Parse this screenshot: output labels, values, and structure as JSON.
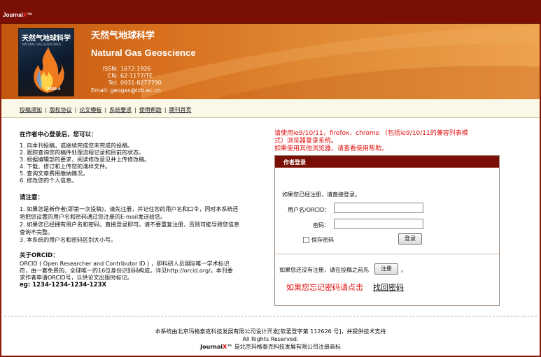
{
  "topbar": {
    "brand_prefix": "Journal",
    "brand_x": "X",
    "brand_tm": "™"
  },
  "journal": {
    "title_cn": "天然气地球科学",
    "title_en": "Natural Gas Geoscience",
    "cover_title": "天然气地球科学",
    "cover_subtitle": "NATURAL GAS GEOSCIENCE",
    "cover_year": "2020.4",
    "issn_label": "ISSN:",
    "issn": "1672-1926",
    "cn_label": "CN:",
    "cn": "62-1177/TE",
    "tel_label": "Tel:",
    "tel": "0931-8277790",
    "email_label": "Email:",
    "email": "geogas@lzb.ac.cn"
  },
  "nav": {
    "items": [
      "投稿须知",
      "版权协议",
      "论文模板",
      "系统要求",
      "使用帮助",
      "期刊首页"
    ],
    "sep": "|"
  },
  "intro": {
    "heading": "在作者中心登录后，您可以：",
    "items": [
      "1. 向本刊投稿，或继续完成您未完成的投稿。",
      "2. 跟踪查询您的稿件处理流程记录和目前的状态。",
      "3. 根据编辑部的要求，阅读修改意见并上传修改稿。",
      "4. 下载、修订和上传您的清样文件。",
      "5. 查询文章费用缴纳情况。",
      "6. 修改您的个人信息。"
    ]
  },
  "notice": {
    "heading": "请注意：",
    "lines": [
      "1. 如果您是新作者(即第一次投稿)，请先注册，并记住您的用户名和口令，同时本系统还",
      "将把您设置的用户名和密码通过您注册的E-mail发送给您。",
      "2. 如果您已经拥有用户名和密码，直接登录即可。请不要重复注册，否则可能导致您信息",
      "查询不完整。",
      "3. 本系统的用户名和密码区别大小写。"
    ]
  },
  "orcid": {
    "heading": "关于ORCID：",
    "lines": [
      "ORCID ( Open Researcher and Contributor ID ) ，即科研人员国际唯一学术标识",
      "符，由一套免费的、全球唯一的16位身份识别码构成，详见http://orcid.org/。本刊要",
      "求作者申请ORCID号，以供论文出版时标记。"
    ],
    "example": "eg: 1234-1234-1234-123X"
  },
  "browser_note": {
    "lines": [
      "请使用ie9/10/11，firefox，chrome （包括ie9/10/11的兼容列表模",
      "式）浏览器登录系统。",
      "如果使用其他浏览器，请查看使用帮助。"
    ]
  },
  "login": {
    "header": "作者登录",
    "hint": "如果您已经注册，请直接登录。",
    "username_label": "用户名/ORCID：",
    "password_label": "密码：",
    "username_value": "",
    "password_value": "",
    "remember_label": "保存密码",
    "login_button": "登录",
    "register_text": "如果您还没有注册，请在投稿之前先",
    "register_button": "注册",
    "register_suffix": "。",
    "forgot_text": "如果您忘记密码请点击",
    "forgot_link": "找回密码"
  },
  "footer": {
    "line1": "本系统由北京玛格泰克科技发展有限公司设计开发[软著登字第 112626 号]，并提供技术支持",
    "line2": "All Rights Reserved.",
    "line3_prefix": "Journal",
    "line3_x": "X",
    "line3_tm": "™",
    "line3_suffix": " 是北京玛格泰克科技发展有限公司注册商标"
  }
}
